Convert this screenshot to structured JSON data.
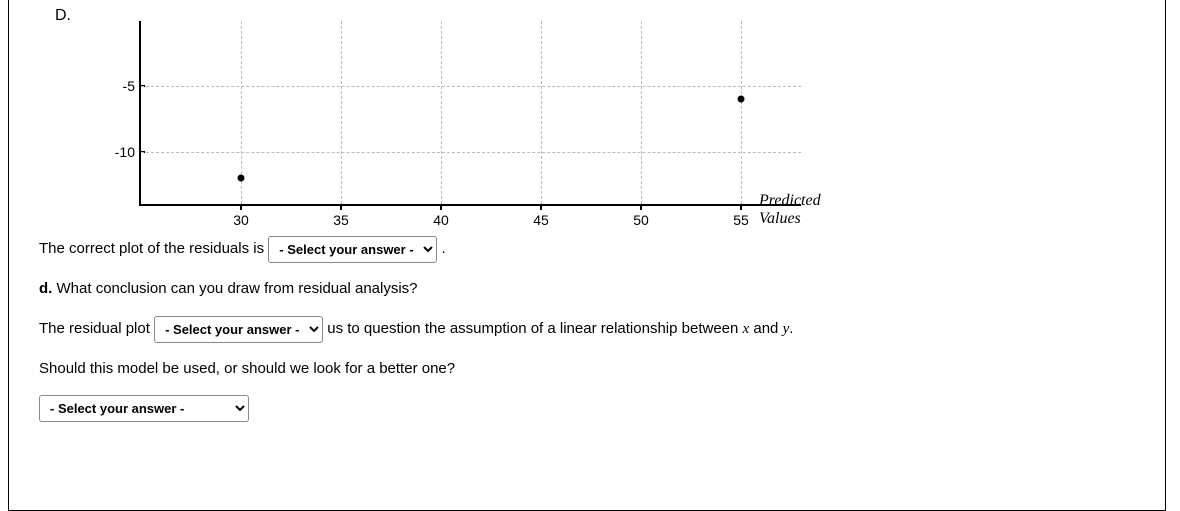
{
  "option": "D.",
  "chart_data": {
    "type": "scatter",
    "xlabel": "Predicted Values",
    "ylabel": "",
    "xticks": [
      30,
      35,
      40,
      45,
      50,
      55
    ],
    "yticks": [
      -5,
      -10
    ],
    "xlim": [
      25,
      58
    ],
    "ylim": [
      -14,
      0
    ],
    "points": [
      {
        "x": 30,
        "y": -12
      },
      {
        "x": 55,
        "y": -6
      }
    ]
  },
  "q_plot": {
    "pre": "The correct plot of the residuals is",
    "select": "- Select your answer -",
    "post": "."
  },
  "q_d": {
    "label": "d.",
    "text": "What conclusion can you draw from residual analysis?"
  },
  "q_residual": {
    "pre": "The residual plot",
    "select": "- Select your answer -",
    "post_a": "us to question the assumption of a linear relationship between",
    "var_x": "x",
    "and": "and",
    "var_y": "y",
    "post_b": "."
  },
  "q_model": {
    "text": "Should this model be used, or should we look for a better one?",
    "select": "- Select your answer -"
  }
}
